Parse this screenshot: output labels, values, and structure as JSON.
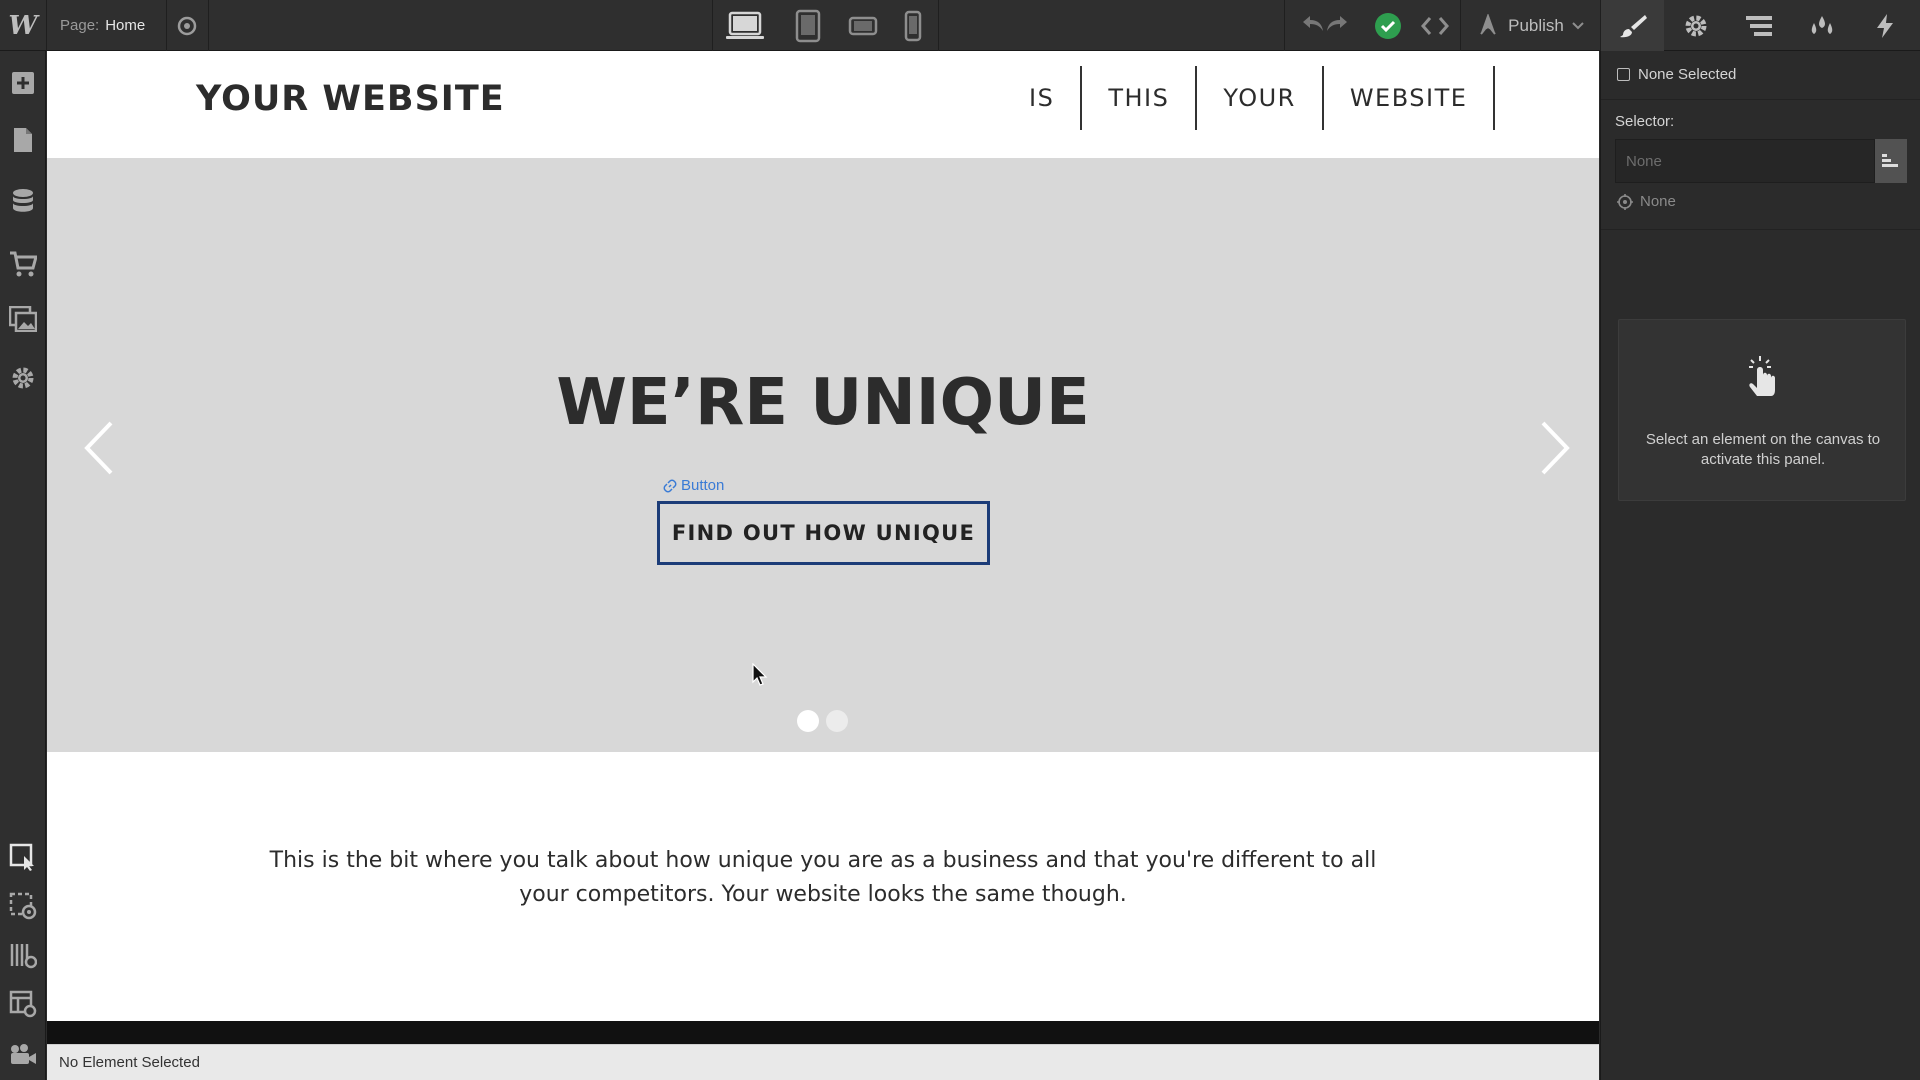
{
  "topbar": {
    "logo": "W",
    "page_label": "Page:",
    "page_name": "Home",
    "publish_label": "Publish"
  },
  "canvas": {
    "brand": "YOUR WEBSITE",
    "nav": [
      "IS",
      "THIS",
      "YOUR",
      "WEBSITE"
    ],
    "hero_title": "WE’RE UNIQUE",
    "button_tag": "Button",
    "cta_label": "FIND OUT HOW UNIQUE",
    "body_text": "This is the bit where you talk about how unique you are as a business and that you're different to all your competitors. Your website looks the same though."
  },
  "statusbar": {
    "text": "No Element Selected"
  },
  "panel": {
    "none_selected": "None Selected",
    "selector_label": "Selector:",
    "selector_placeholder": "None",
    "inherit_none": "None",
    "empty_message": "Select an element on the canvas to activate this panel."
  },
  "colors": {
    "accent": "#3a7bd5",
    "success": "#2e9e4f",
    "selection_outline": "#1c3c78"
  }
}
